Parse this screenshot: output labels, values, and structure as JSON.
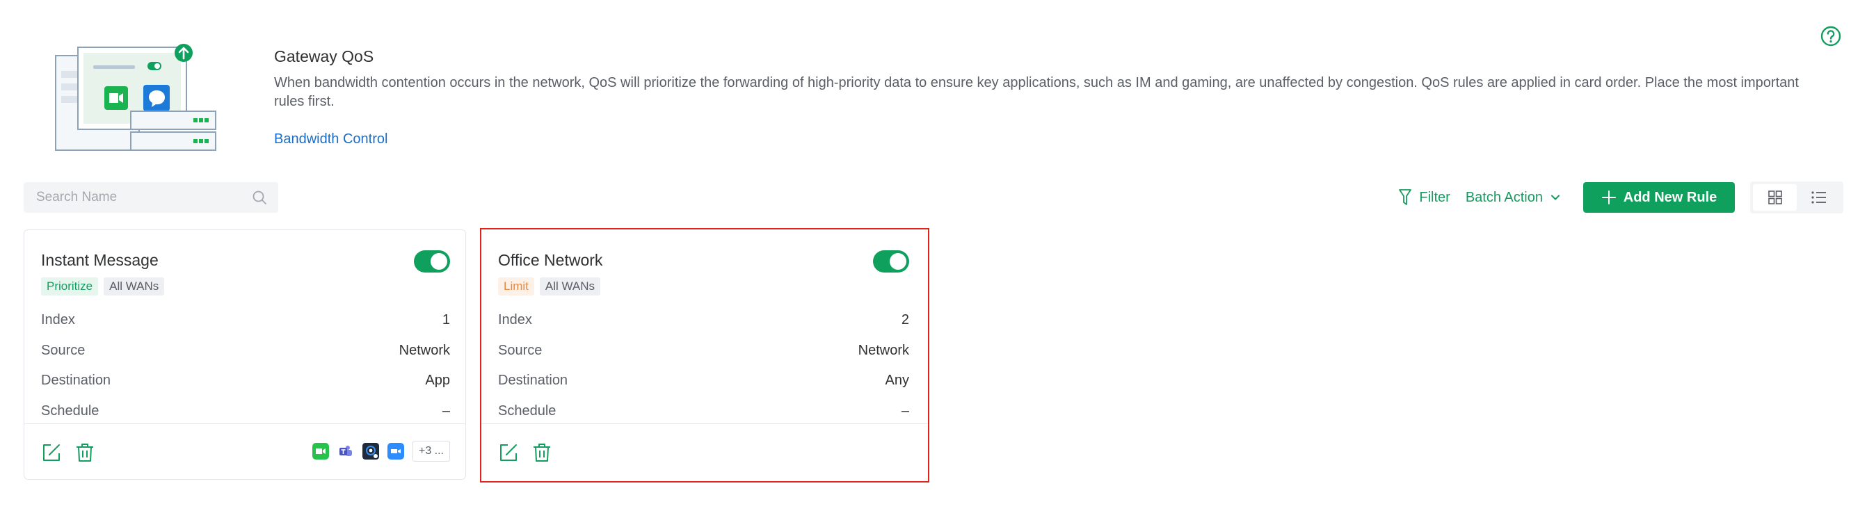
{
  "header": {
    "title": "Gateway QoS",
    "description": "When bandwidth contention occurs in the network, QoS will prioritize the forwarding of high-priority data to ensure key applications, such as IM and gaming, are unaffected by congestion. QoS rules are applied in card order. Place the most important rules first.",
    "link": "Bandwidth Control"
  },
  "toolbar": {
    "search_placeholder": "Search Name",
    "filter_label": "Filter",
    "batch_label": "Batch Action",
    "add_label": "Add New Rule"
  },
  "colors": {
    "primary": "#0ea05c",
    "link": "#1a6ec7",
    "selection": "#e3221c"
  },
  "cards": [
    {
      "title": "Instant Message",
      "enabled": true,
      "tags": [
        "Prioritize",
        "All WANs"
      ],
      "rows": [
        {
          "key": "Index",
          "value": "1"
        },
        {
          "key": "Source",
          "value": "Network"
        },
        {
          "key": "Destination",
          "value": "App"
        },
        {
          "key": "Schedule",
          "value": "–"
        }
      ],
      "apps": [
        "facetime-icon",
        "teams-icon",
        "signal-icon",
        "zoom-icon"
      ],
      "more_label": "+3 ..."
    },
    {
      "title": "Office Network",
      "enabled": true,
      "tags": [
        "Limit",
        "All WANs"
      ],
      "rows": [
        {
          "key": "Index",
          "value": "2"
        },
        {
          "key": "Source",
          "value": "Network"
        },
        {
          "key": "Destination",
          "value": "Any"
        },
        {
          "key": "Schedule",
          "value": "–"
        }
      ]
    }
  ]
}
